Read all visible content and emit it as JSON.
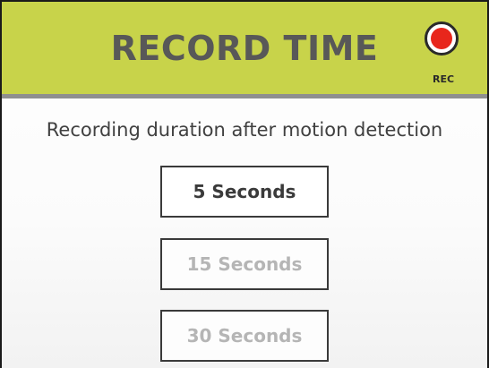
{
  "header": {
    "title": "RECORD TIME",
    "rec_label": "REC",
    "accent_color": "#c8d34a",
    "rec_color": "#e8261c"
  },
  "subtitle": "Recording duration after motion detection",
  "options": [
    {
      "label": "5 Seconds",
      "selected": true
    },
    {
      "label": "15 Seconds",
      "selected": false
    },
    {
      "label": "30 Seconds",
      "selected": false
    }
  ]
}
